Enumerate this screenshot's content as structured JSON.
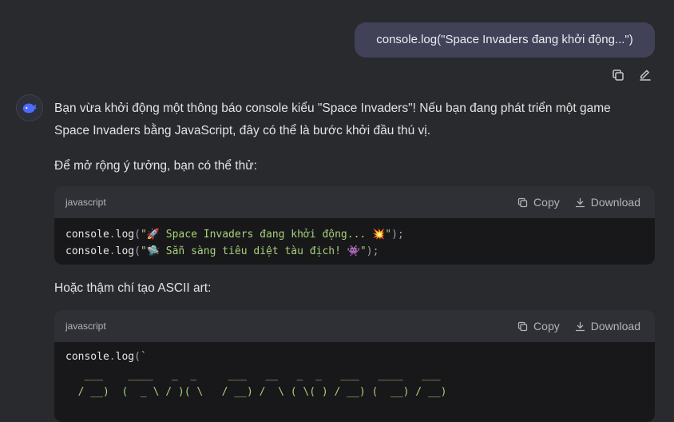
{
  "user_message": {
    "text": "console.log(\"Space Invaders đang khởi động...\")"
  },
  "message_actions": {
    "copy_icon": "copy-icon",
    "edit_icon": "edit-icon"
  },
  "assistant": {
    "avatar_icon": "whale-icon",
    "paragraph_1": "Bạn vừa khởi động một thông báo console kiểu \"Space Invaders\"! Nếu bạn đang phát triển một game Space Invaders bằng JavaScript, đây có thể là bước khởi đầu thú vị.",
    "paragraph_2": "Để mở rộng ý tưởng, bạn có thể thử:",
    "paragraph_3": "Hoặc thậm chí tạo ASCII art:"
  },
  "code_block_1": {
    "language": "javascript",
    "copy_label": "Copy",
    "download_label": "Download",
    "lines": [
      {
        "obj": "console",
        "dot": ".",
        "fn": "log",
        "open": "(",
        "str": "\"🚀 Space Invaders đang khởi động... 💥\"",
        "close": ");"
      },
      {
        "obj": "console",
        "dot": ".",
        "fn": "log",
        "open": "(",
        "str": "\"🛸 Sẵn sàng tiêu diệt tàu địch! 👾\"",
        "close": ");"
      }
    ]
  },
  "code_block_2": {
    "language": "javascript",
    "copy_label": "Copy",
    "download_label": "Download",
    "line_1": {
      "obj": "console",
      "dot": ".",
      "fn": "log",
      "open": "(",
      "str": "`"
    },
    "ascii_line_1": "   ___    ____   _  _     ___   __   _  _   ___   ____   ___",
    "ascii_line_2": "  / __)  (  _ \\ / )( \\   / __) /  \\ ( \\( ) / __) (  __) / __)"
  },
  "colors": {
    "background": "#292a2d",
    "user_bubble": "#414158",
    "code_bg": "#18181b",
    "code_header": "#2f3035",
    "string": "#a7d178"
  }
}
